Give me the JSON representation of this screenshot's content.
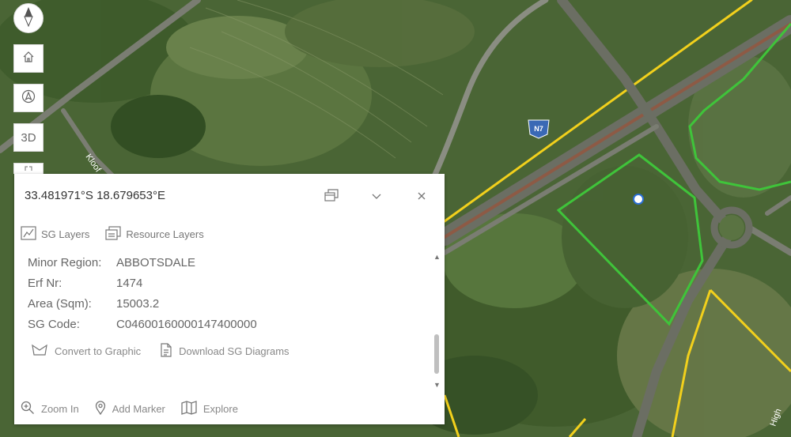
{
  "map": {
    "shield_label": "N7",
    "street_left": "Kloof",
    "street_right": "High"
  },
  "controls": {
    "compass_icon": "compass-icon",
    "home_icon": "home-icon",
    "locate_icon": "navigation-arrow-icon",
    "threed_label": "3D"
  },
  "popup": {
    "coordinates": "33.481971°S 18.679653°E",
    "tabs": [
      {
        "label": "SG Layers"
      },
      {
        "label": "Resource Layers"
      }
    ],
    "attributes": [
      {
        "key": "Minor Region:",
        "value": "ABBOTSDALE"
      },
      {
        "key": "Erf Nr:",
        "value": "1474"
      },
      {
        "key": "Area (Sqm):",
        "value": "15003.2"
      },
      {
        "key": "SG Code:",
        "value": "C04600160000147400000"
      }
    ],
    "actions": {
      "convert": "Convert to Graphic",
      "download": "Download SG Diagrams"
    },
    "footer": {
      "zoom_in": "Zoom In",
      "add_marker": "Add Marker",
      "explore": "Explore"
    }
  },
  "colors": {
    "parcel_green": "#3fc43a",
    "parcel_yellow": "#f2d01c",
    "road": "#6b6e63"
  }
}
